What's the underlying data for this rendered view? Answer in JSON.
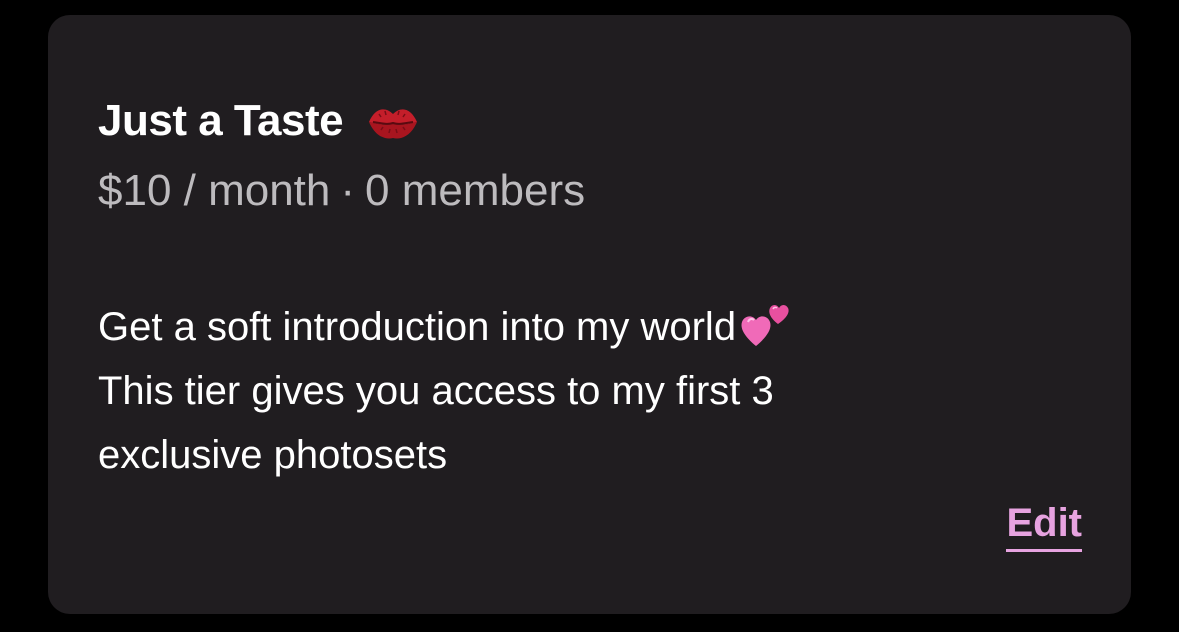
{
  "tier": {
    "name": "Just a Taste",
    "name_icon": "kiss-lips-icon",
    "price": "$10 / month",
    "separator": "·",
    "members": "0 members",
    "description": {
      "line1": "Get a soft introduction into my world",
      "line1_icon": "two-hearts-icon",
      "line2": "This tier gives you access to my first 3",
      "line3": "exclusive photosets"
    },
    "edit_label": "Edit"
  },
  "colors": {
    "background": "#000000",
    "card": "#201d20",
    "title": "#ffffff",
    "meta": "#bdbbbe",
    "accent": "#e7a3e0",
    "lips": "#c41e2a",
    "hearts": "#f06ab8"
  }
}
